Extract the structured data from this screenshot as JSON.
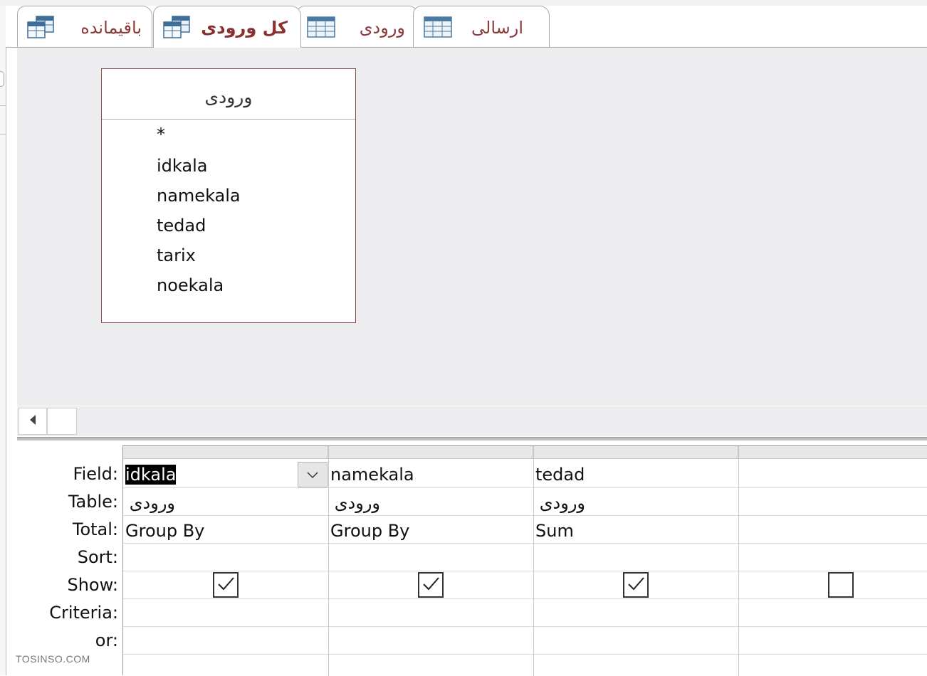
{
  "tabs": [
    {
      "label": "باقیمانده",
      "icon": "query-icon",
      "active": false
    },
    {
      "label": "کل ورودی",
      "icon": "query-icon",
      "active": true
    },
    {
      "label": "ورودی",
      "icon": "table-icon",
      "active": false
    },
    {
      "label": "ارسالی",
      "icon": "table-icon",
      "active": false
    }
  ],
  "table_box": {
    "title": "ورودی",
    "fields": [
      "*",
      "idkala",
      "namekala",
      "tedad",
      "tarix",
      "noekala"
    ]
  },
  "grid": {
    "row_labels": {
      "field": "Field:",
      "table": "Table:",
      "total": "Total:",
      "sort": "Sort:",
      "show": "Show:",
      "criteria": "Criteria:",
      "or": "or:"
    },
    "columns": [
      {
        "field": "idkala",
        "table": "ورودی",
        "total": "Group By",
        "show": true
      },
      {
        "field": "namekala",
        "table": "ورودی",
        "total": "Group By",
        "show": true
      },
      {
        "field": "tedad",
        "table": "ورودی",
        "total": "Sum",
        "show": true
      },
      {
        "field": "",
        "table": "",
        "total": "",
        "show": false
      }
    ]
  },
  "watermark": "TOSINSO.COM",
  "colors": {
    "accent_tab_text": "#8c2f2f",
    "design_bg": "#ededf0",
    "table_border": "#8e4b4b"
  }
}
